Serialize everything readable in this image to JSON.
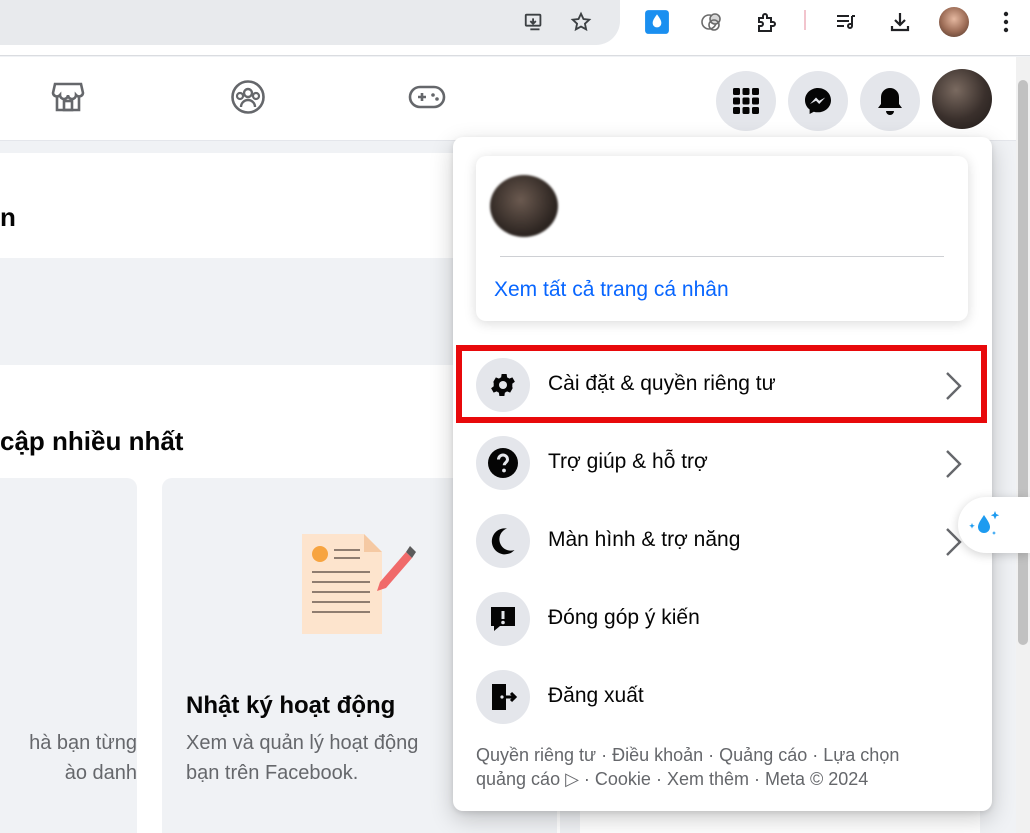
{
  "browser": {
    "icons": [
      "install-app-icon",
      "bookmark-star-icon",
      "water-drop-extension-icon",
      "extension-circles-icon",
      "puzzle-extensions-icon",
      "media-queue-icon",
      "download-icon",
      "profile-avatar-icon",
      "more-vert-icon"
    ]
  },
  "nav": {
    "tabs": [
      "marketplace-icon",
      "groups-icon",
      "gaming-icon"
    ],
    "actions": [
      "menu-grid-icon",
      "messenger-icon",
      "notifications-bell-icon",
      "account-avatar"
    ]
  },
  "background": {
    "section_title_1": "n",
    "section_title_2": "cập nhiều nhất",
    "card1_text_line1": "hà bạn từng",
    "card1_text_line2": "ào danh",
    "card2_title": "Nhật ký hoạt động",
    "card2_text_line1": "Xem và quản lý hoạt động",
    "card2_text_line2": "bạn trên Facebook."
  },
  "menu": {
    "profile_link": "Xem tất cả trang cá nhân",
    "items": [
      {
        "label": "Cài đặt & quyền riêng tư",
        "icon": "gear-icon",
        "chevron": true
      },
      {
        "label": "Trợ giúp & hỗ trợ",
        "icon": "help-question-icon",
        "chevron": true
      },
      {
        "label": "Màn hình & trợ năng",
        "icon": "moon-icon",
        "chevron": true
      },
      {
        "label": "Đóng góp ý kiến",
        "icon": "feedback-exclamation-icon",
        "chevron": false
      },
      {
        "label": "Đăng xuất",
        "icon": "logout-door-icon",
        "chevron": false
      }
    ],
    "footer_line1": "Quyền riêng tư · Điều khoản · Quảng cáo · Lựa chọn",
    "footer_line2": "quảng cáo ▷ · Cookie · Xem thêm · Meta © 2024"
  },
  "colors": {
    "accent": "#0866ff",
    "highlight": "#e8090b",
    "icon_bg": "#e4e6eb",
    "secondary_text": "#65676b"
  }
}
